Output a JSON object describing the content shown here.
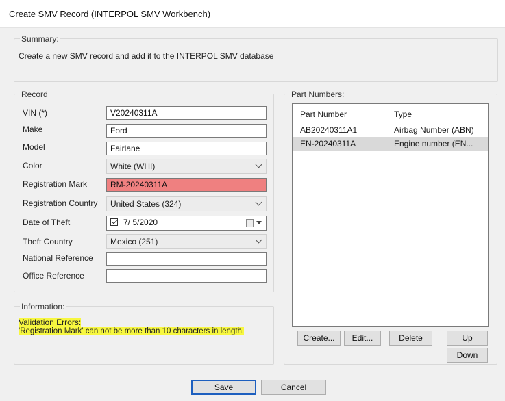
{
  "window": {
    "title": "Create SMV Record (INTERPOL SMV Workbench)"
  },
  "summary": {
    "legend": "Summary:",
    "text": "Create a new SMV record and add it to the INTERPOL SMV database"
  },
  "record": {
    "legend": "Record",
    "vin_label": "VIN (*)",
    "vin_value": "V20240311A",
    "make_label": "Make",
    "make_value": "Ford",
    "model_label": "Model",
    "model_value": "Fairlane",
    "color_label": "Color",
    "color_value": "White (WHI)",
    "regmark_label": "Registration Mark",
    "regmark_value": "RM-20240311A",
    "regcountry_label": "Registration Country",
    "regcountry_value": "United States (324)",
    "dot_label": "Date of Theft",
    "dot_value": "7/ 5/2020",
    "theftcountry_label": "Theft Country",
    "theftcountry_value": "Mexico (251)",
    "natref_label": "National Reference",
    "natref_value": "",
    "officeref_label": "Office Reference",
    "officeref_value": ""
  },
  "information": {
    "legend": "Information:",
    "line1": "Validation Errors:",
    "line2": "'Registration Mark' can not be more than 10 characters in length."
  },
  "parts": {
    "legend": "Part Numbers:",
    "col_number": "Part Number",
    "col_type": "Type",
    "rows": [
      {
        "number": "AB20240311A1",
        "type": "Airbag Number (ABN)"
      },
      {
        "number": "EN-20240311A",
        "type": "Engine number (EN..."
      }
    ],
    "create": "Create...",
    "edit": "Edit...",
    "delete": "Delete",
    "up": "Up",
    "down": "Down"
  },
  "footer": {
    "save": "Save",
    "cancel": "Cancel"
  },
  "colors": {
    "error_bg": "#ef8080",
    "highlight": "#f7f73f",
    "default_button_border": "#1d5fbf"
  }
}
